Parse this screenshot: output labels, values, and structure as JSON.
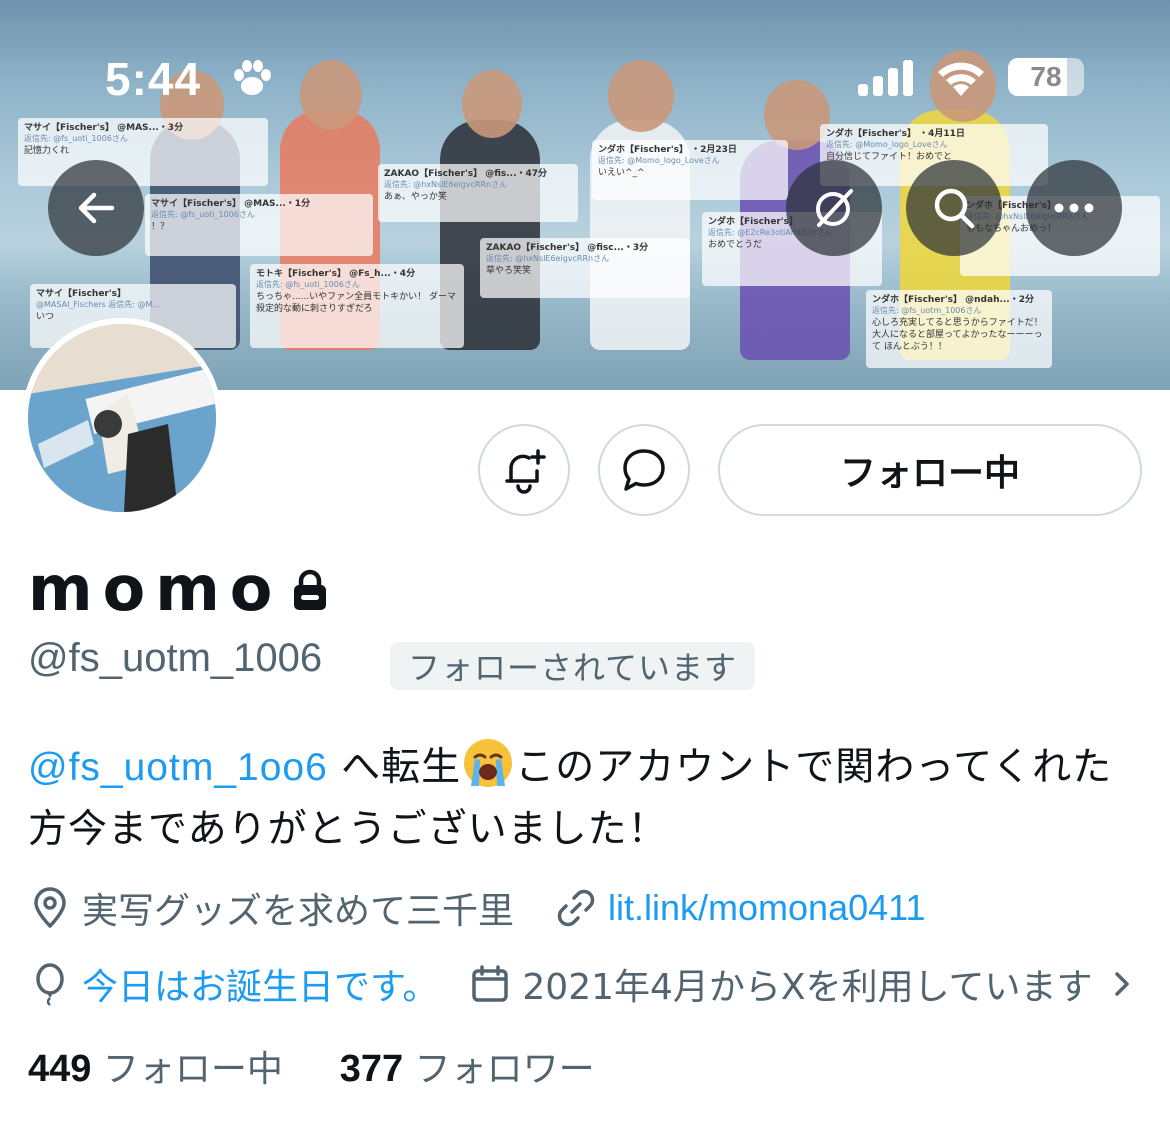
{
  "status_bar": {
    "time": "5:44",
    "battery": "78",
    "battery_level": 0.78
  },
  "banner": {
    "tweets": [
      {
        "name": "マサイ【Fischer's】",
        "handle": "@MAS...・3分",
        "reply": "返信先: @fs_uoti_1006さん",
        "body": "記憶力くれ"
      },
      {
        "name": "マサイ【Fischer's】",
        "handle": "@MAS...・1分",
        "reply": "返信先: @fs_uoti_1006さん",
        "body": "！？"
      },
      {
        "name": "ZAKAO【Fischer's】",
        "handle": "@fis...・47分",
        "reply": "返信先: @hxNslE6eigvcRRnさん",
        "body": "あぁ、やっか笑"
      },
      {
        "name": "ンダホ【Fischer's】",
        "handle": "・2月23日",
        "reply": "返信先: @Momo_logo_Loveさん",
        "body": "いえい^_^"
      },
      {
        "name": "ンダホ【Fischer's】",
        "handle": "・4月11日",
        "reply": "返信先: @Momo_logo_Loveさん",
        "body": "自分信じてファイト！おめでと"
      },
      {
        "name": "ZAKAO【Fischer's】",
        "handle": "@fisc...・3分",
        "reply": "返信先: @hxNslE6eigvcRRnさん",
        "body": "草やろ笑笑"
      },
      {
        "name": "モトキ【Fischer's】",
        "handle": "@Fs_h...・4分",
        "reply": "返信先: @fs_uoti_1006さん",
        "body": "ちっちゃ......いやファン全員モトキかい！ ダーマ殺定的な動に刺さりすぎだろ"
      },
      {
        "name": "ンダホ【Fischer's】",
        "handle": "",
        "reply": "返信先: @E2cRe3otiAml6Znさん",
        "body": "おめでとうだ"
      },
      {
        "name": "ンダホ【Fischer's】",
        "handle": "",
        "reply": "返信先: @hxNslE6eigvcRRnさん",
        "body": "ももなちゃんおめっ！"
      },
      {
        "name": "マサイ【Fischer's】",
        "handle": "@MASAI_Fischers",
        "reply": "返信先: @M...",
        "body": "いつ"
      },
      {
        "name": "ンダホ【Fischer's】",
        "handle": "@ndah...・2分",
        "reply": "返信先: @fs_uotm_1006さん",
        "body": "心しろ充実してると思うからファイトだ！大人になると部屋ってよかったなーーーって ほんとぶう！！"
      }
    ]
  },
  "nav": {
    "back_icon": "arrow-left-icon",
    "grok_icon": "grok-icon",
    "search_icon": "search-icon",
    "more_icon": "more-icon"
  },
  "profile": {
    "display_name": "momo",
    "handle": "@fs_uotm_1006",
    "follows_you": "フォローされています",
    "follow_button": "フォロー中",
    "bio_mention": "@fs_uotm_1oo6",
    "bio_part1": " へ転生",
    "bio_part2": "このアカウントで関わってくれた方今までありがとうございました！",
    "location": "実写グッズを求めて三千里",
    "link": "lit.link/momona0411",
    "birthday": "今日はお誕生日です。",
    "joined": "2021年4月からXを利用しています",
    "following_count": "449",
    "following_label": "フォロー中",
    "followers_count": "377",
    "followers_label": "フォロワー"
  },
  "colors": {
    "accent": "#1d9bf0",
    "secondary_text": "#536471",
    "border": "#cfd9de"
  }
}
